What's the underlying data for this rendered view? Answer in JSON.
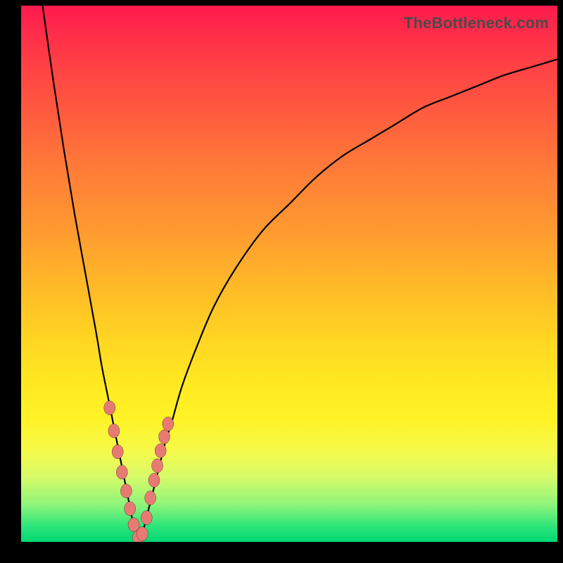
{
  "watermark": "TheBottleneck.com",
  "colors": {
    "frame": "#000000",
    "curve": "#000000",
    "marker_fill": "#e87a74",
    "gradient_top": "#ff1a4d",
    "gradient_bottom": "#00d873"
  },
  "chart_data": {
    "type": "line",
    "title": "",
    "xlabel": "",
    "ylabel": "",
    "xlim": [
      0,
      100
    ],
    "ylim": [
      0,
      100
    ],
    "notes": "V-shaped bottleneck curve. Minimum (≈0) near x≈22. Left branch rises steeply toward 100 as x→0. Right branch rises with decreasing slope toward ≈90 as x→100. Values estimated from pixel positions; axes unlabeled.",
    "series": [
      {
        "name": "left-branch",
        "x": [
          4,
          6,
          8,
          10,
          12,
          14,
          15,
          16,
          17,
          18,
          19,
          20,
          21,
          22
        ],
        "y": [
          100,
          86,
          73,
          61,
          50,
          39,
          33,
          28,
          23,
          18,
          13,
          8,
          3,
          0
        ]
      },
      {
        "name": "right-branch",
        "x": [
          22,
          23,
          24,
          25,
          26,
          27,
          28,
          30,
          33,
          36,
          40,
          45,
          50,
          55,
          60,
          65,
          70,
          75,
          80,
          85,
          90,
          95,
          100
        ],
        "y": [
          0,
          3,
          7,
          11,
          15,
          19,
          22,
          29,
          37,
          44,
          51,
          58,
          63,
          68,
          72,
          75,
          78,
          81,
          83,
          85,
          87,
          88.5,
          90
        ]
      }
    ],
    "markers": {
      "name": "highlighted-points",
      "x": [
        16.5,
        17.3,
        18.0,
        18.8,
        19.6,
        20.3,
        21.0,
        21.8,
        22.6,
        23.4,
        24.1,
        24.8,
        25.4,
        26.0,
        26.7,
        27.4
      ],
      "y": [
        25.0,
        20.7,
        16.8,
        13.0,
        9.5,
        6.2,
        3.2,
        0.8,
        1.5,
        4.5,
        8.2,
        11.5,
        14.2,
        17.0,
        19.6,
        22.0
      ]
    }
  }
}
